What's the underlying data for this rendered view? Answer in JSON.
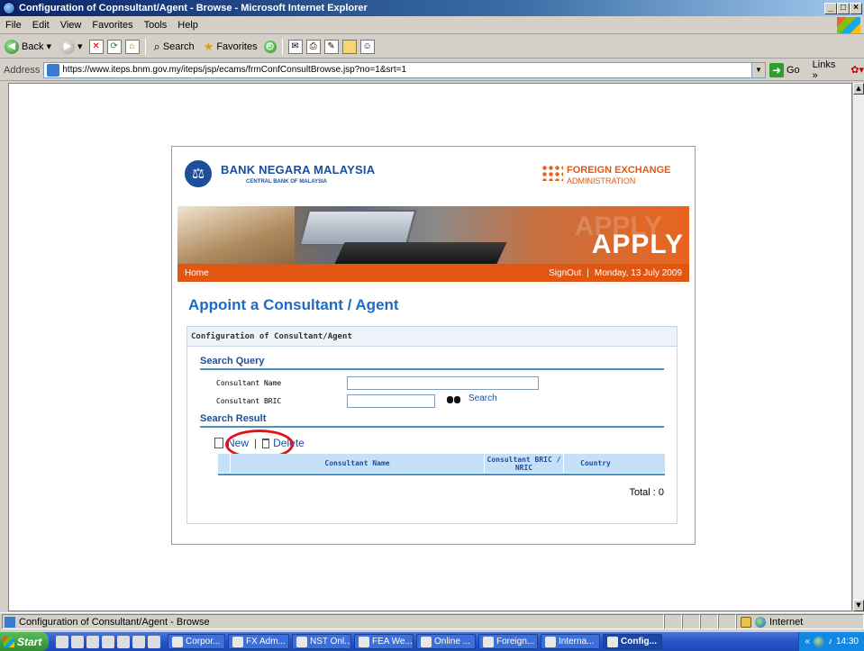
{
  "window": {
    "title": "Configuration of Copnsultant/Agent - Browse - Microsoft Internet Explorer",
    "minimize": "_",
    "maximize": "□",
    "close": "×"
  },
  "menu": [
    "File",
    "Edit",
    "View",
    "Favorites",
    "Tools",
    "Help"
  ],
  "toolbar": {
    "back": "Back",
    "search": "Search",
    "favorites": "Favorites"
  },
  "address": {
    "label": "Address",
    "url": "https://www.iteps.bnm.gov.my/iteps/jsp/ecams/frmConfConsultBrowse.jsp?no=1&srt=1",
    "go": "Go",
    "links": "Links"
  },
  "header": {
    "bank_name": "BANK NEGARA MALAYSIA",
    "bank_sub": "CENTRAL BANK OF MALAYSIA",
    "fx_name": "FOREIGN EXCHANGE",
    "fx_sub": "ADMINISTRATION"
  },
  "banner": {
    "word": "APPLY"
  },
  "nav": {
    "home": "Home",
    "signout": "SignOut",
    "divider": "|",
    "date": "Monday, 13 July 2009"
  },
  "main": {
    "heading": "Appoint a Consultant / Agent",
    "box_title": "Configuration of Consultant/Agent",
    "search_query_title": "Search Query",
    "consultant_name_label": "Consultant Name",
    "consultant_bric_label": "Consultant BRIC",
    "consultant_name_value": "",
    "consultant_bric_value": "",
    "search_label": "Search",
    "search_result_title": "Search Result",
    "new_label": "New",
    "action_divider": "|",
    "delete_label": "Delete",
    "columns": {
      "name": "Consultant Name",
      "bric": "Consultant BRIC / NRIC",
      "country": "Country"
    },
    "total": "Total : 0"
  },
  "status": {
    "text": "Configuration of Consultant/Agent - Browse",
    "zone": "Internet"
  },
  "taskbar": {
    "start": "Start",
    "tasks": [
      "Corpor...",
      "FX Adm...",
      "NST Onl...",
      "FEA We...",
      "Online ...",
      "Foreign...",
      "Interna...",
      "Config..."
    ],
    "clock": "14:30"
  },
  "colors": {
    "nav_orange": "#e15610",
    "heading_blue": "#1e6bc5",
    "highlight_red": "#e0141e"
  }
}
